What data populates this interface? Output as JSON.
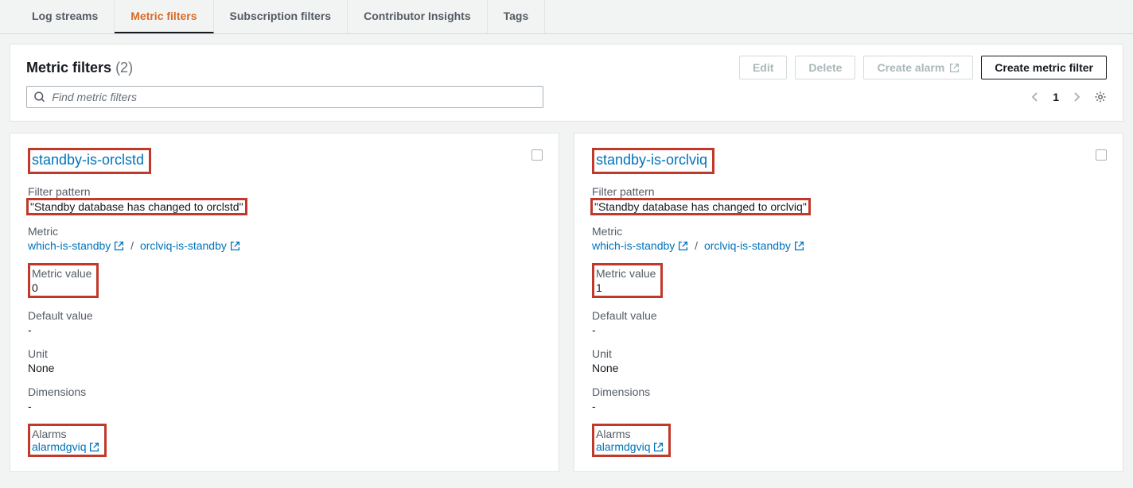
{
  "tabs": {
    "log_streams": "Log streams",
    "metric_filters": "Metric filters",
    "subscription_filters": "Subscription filters",
    "contributor_insights": "Contributor Insights",
    "tags": "Tags"
  },
  "panel": {
    "title": "Metric filters",
    "count": "(2)",
    "buttons": {
      "edit": "Edit",
      "delete": "Delete",
      "create_alarm": "Create alarm",
      "create_metric_filter": "Create metric filter"
    },
    "search_placeholder": "Find metric filters",
    "page": "1"
  },
  "labels": {
    "filter_pattern": "Filter pattern",
    "metric": "Metric",
    "metric_value": "Metric value",
    "default_value": "Default value",
    "unit": "Unit",
    "dimensions": "Dimensions",
    "alarms": "Alarms"
  },
  "cards": [
    {
      "title": "standby-is-orclstd",
      "pattern": "\"Standby database has changed to orclstd\"",
      "metric_ns": "which-is-standby",
      "metric_name": "orclviq-is-standby",
      "metric_value": "0",
      "default_value": "-",
      "unit": "None",
      "dimensions": "-",
      "alarm": "alarmdgviq"
    },
    {
      "title": "standby-is-orclviq",
      "pattern": "\"Standby database has changed to orclviq\"",
      "metric_ns": "which-is-standby",
      "metric_name": "orclviq-is-standby",
      "metric_value": "1",
      "default_value": "-",
      "unit": "None",
      "dimensions": "-",
      "alarm": "alarmdgviq"
    }
  ]
}
